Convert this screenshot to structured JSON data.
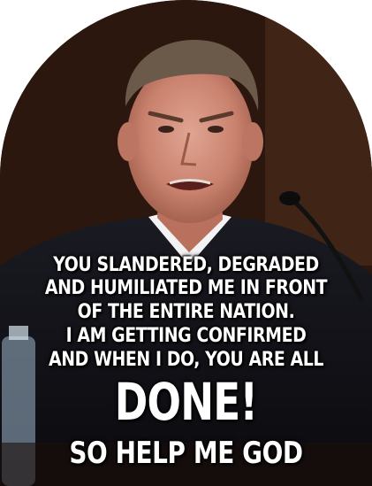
{
  "meme": {
    "lines": [
      "YOU SLANDERED, DEGRADED",
      "AND HUMILIATED ME IN FRONT",
      "OF THE ENTIRE NATION.",
      "I AM GETTING CONFIRMED",
      "AND WHEN I DO, YOU ARE ALL",
      "DONE!",
      "SO HELP ME GOD"
    ]
  },
  "colors": {
    "background": "#ffffff",
    "text": "#ffffff",
    "text_shadow": "#000000"
  }
}
